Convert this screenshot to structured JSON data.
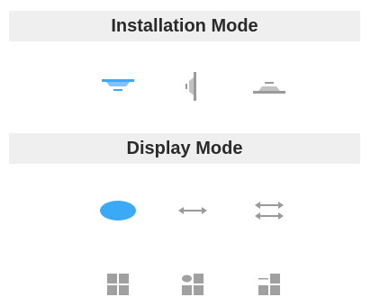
{
  "installation": {
    "title": "Installation Mode",
    "options": [
      {
        "icon": "ceiling-mount-icon",
        "selected": true
      },
      {
        "icon": "wall-mount-icon",
        "selected": false
      },
      {
        "icon": "table-mount-icon",
        "selected": false
      }
    ]
  },
  "display": {
    "title": "Display Mode",
    "modes": [
      {
        "icon": "fisheye-original-icon",
        "selected": true
      },
      {
        "icon": "panorama-single-icon",
        "selected": false
      },
      {
        "icon": "panorama-dual-icon",
        "selected": false
      }
    ],
    "layouts": [
      {
        "icon": "layout-quad-grid-icon",
        "selected": false
      },
      {
        "icon": "layout-fisheye-plus-three-icon",
        "selected": false
      },
      {
        "icon": "layout-panorama-plus-three-icon",
        "selected": false
      }
    ]
  },
  "colors": {
    "accent": "#3ba9f5",
    "icon_gray": "#9a9a9a",
    "header_bg": "#efefef",
    "header_text": "#2a2a2a"
  }
}
